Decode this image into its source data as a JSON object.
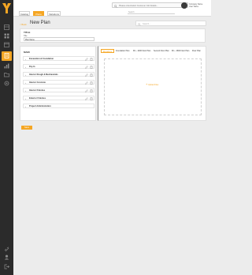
{
  "brand": {
    "accent": "#f5a623",
    "sidebar_bg": "#2b2b2b"
  },
  "sidebar": {
    "logo": "y-logo",
    "icons": [
      "dashboard-icon",
      "grid-icon",
      "calendar-icon",
      "chart-icon",
      "document-icon",
      "folder-icon",
      "settings-icon"
    ],
    "bottom_icons": [
      "link-icon",
      "user-icon",
      "logout-icon"
    ]
  },
  "header": {
    "tabs": [
      {
        "label": "Catalog",
        "active": false
      },
      {
        "label": "Plans",
        "active": true
      },
      {
        "label": "Variations",
        "active": false
      }
    ],
    "search_text": "Please enter/select Customer Job Details...",
    "filter_placeholder": "Search",
    "user_lines": [
      "Company Name",
      "User Name"
    ]
  },
  "page": {
    "back_label": "< Back",
    "title": "New Plan",
    "search_placeholder": "Search..."
  },
  "title_card": {
    "label": "TITLE",
    "field_label": "Title",
    "field_value": "Plan Name"
  },
  "left_panel": {
    "title": "MAIN",
    "rows": [
      {
        "label": "Excavation & Foundation"
      },
      {
        "label": "Dry-In"
      },
      {
        "label": "Interior Rough & Mechanicals"
      },
      {
        "label": "Interior Concrete"
      },
      {
        "label": "Interior Finishes"
      },
      {
        "label": "Exterior Finishes"
      },
      {
        "label": "Project Administration"
      }
    ]
  },
  "right_panel": {
    "tabs": [
      {
        "label": "Elevations",
        "active": true
      },
      {
        "label": "Foundation Plan",
        "active": false
      },
      {
        "label": "Mn - 1000 Floor Plan",
        "active": false
      },
      {
        "label": "Second Floor Plan",
        "active": false
      },
      {
        "label": "Mn - 1500 Floor Plan",
        "active": false
      },
      {
        "label": "Floor Plan",
        "active": false
      }
    ],
    "upload_label": "Upload Files"
  },
  "save_label": "Save"
}
